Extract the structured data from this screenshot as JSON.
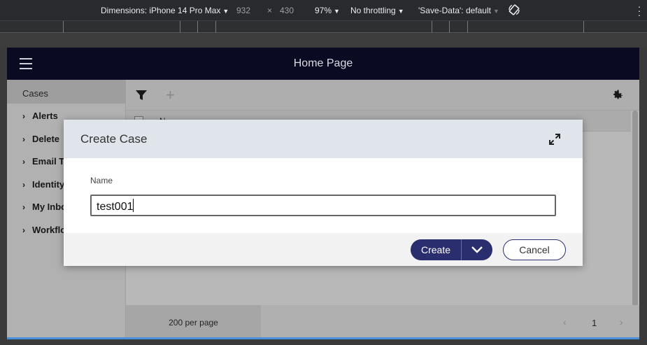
{
  "devtools": {
    "dimensions_label": "Dimensions: iPhone 14 Pro Max",
    "width": "932",
    "times": "×",
    "height": "430",
    "zoom": "97%",
    "throttling": "No throttling",
    "save_data": "'Save-Data': default",
    "caret": "▼",
    "rotate_icon": "rotate-icon",
    "more_icon": "more-vert-icon"
  },
  "app": {
    "title": "Home Page",
    "menu_icon": "hamburger-icon"
  },
  "sidebar": {
    "cases_label": "Cases",
    "items": [
      {
        "label": "Alerts"
      },
      {
        "label": "Delete"
      },
      {
        "label": "Email Te"
      },
      {
        "label": "Identity"
      },
      {
        "label": "My Inbo"
      },
      {
        "label": "Workflo"
      }
    ]
  },
  "content": {
    "column_name": "N",
    "per_page": "200 per page",
    "current_page": "1",
    "prev": "‹",
    "next": "›"
  },
  "modal": {
    "title": "Create Case",
    "expand_icon": "expand-icon",
    "name_label": "Name",
    "name_value": "test001",
    "create_label": "Create",
    "cancel_label": "Cancel"
  },
  "colors": {
    "header_bg": "#0a0b22",
    "primary": "#2b2e6e",
    "modal_header_bg": "#dfe5ea"
  }
}
